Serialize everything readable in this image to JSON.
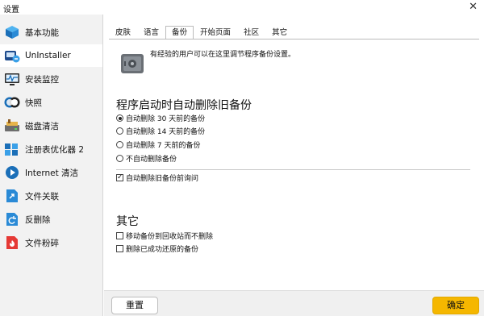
{
  "window": {
    "title": "设置",
    "close_glyph": "✕"
  },
  "sidebar": {
    "items": [
      {
        "label": "基本功能",
        "icon": "cube-icon",
        "active": false
      },
      {
        "label": "UnInstaller",
        "icon": "uninstaller-icon",
        "active": true
      },
      {
        "label": "安装监控",
        "icon": "monitor-icon",
        "active": false
      },
      {
        "label": "快照",
        "icon": "snapshot-icon",
        "active": false
      },
      {
        "label": "磁盘清洁",
        "icon": "disk-cleaner-icon",
        "active": false
      },
      {
        "label": "注册表优化器 2",
        "icon": "registry-icon",
        "active": false
      },
      {
        "label": "Internet 清洁",
        "icon": "internet-icon",
        "active": false
      },
      {
        "label": "文件关联",
        "icon": "file-association-icon",
        "active": false
      },
      {
        "label": "反删除",
        "icon": "undelete-icon",
        "active": false
      },
      {
        "label": "文件粉碎",
        "icon": "shredder-icon",
        "active": false
      }
    ]
  },
  "tabs": [
    {
      "label": "皮肤",
      "active": false
    },
    {
      "label": "语言",
      "active": false
    },
    {
      "label": "备份",
      "active": true
    },
    {
      "label": "开始页面",
      "active": false
    },
    {
      "label": "社区",
      "active": false
    },
    {
      "label": "其它",
      "active": false
    }
  ],
  "intro": {
    "text": "有经验的用户可以在这里调节程序备份设置。",
    "icon": "safe-icon"
  },
  "section1": {
    "title": "程序启动时自动删除旧备份",
    "options": [
      {
        "label": "自动删除 30 天前的备份",
        "selected": true
      },
      {
        "label": "自动删除 14 天前的备份",
        "selected": false
      },
      {
        "label": "自动删除 7 天前的备份",
        "selected": false
      },
      {
        "label": "不自动删除备份",
        "selected": false
      }
    ],
    "ask_label": "自动删除旧备份前询问",
    "ask_checked": true
  },
  "section2": {
    "title": "其它",
    "options": [
      {
        "label": "移动备份到回收站而不删除",
        "checked": false
      },
      {
        "label": "删除已成功还原的备份",
        "checked": false
      }
    ]
  },
  "footer": {
    "reset_label": "重置",
    "ok_label": "确定"
  },
  "colors": {
    "accent": "#f5b700",
    "sidebar_bg": "#f2f2f2"
  }
}
